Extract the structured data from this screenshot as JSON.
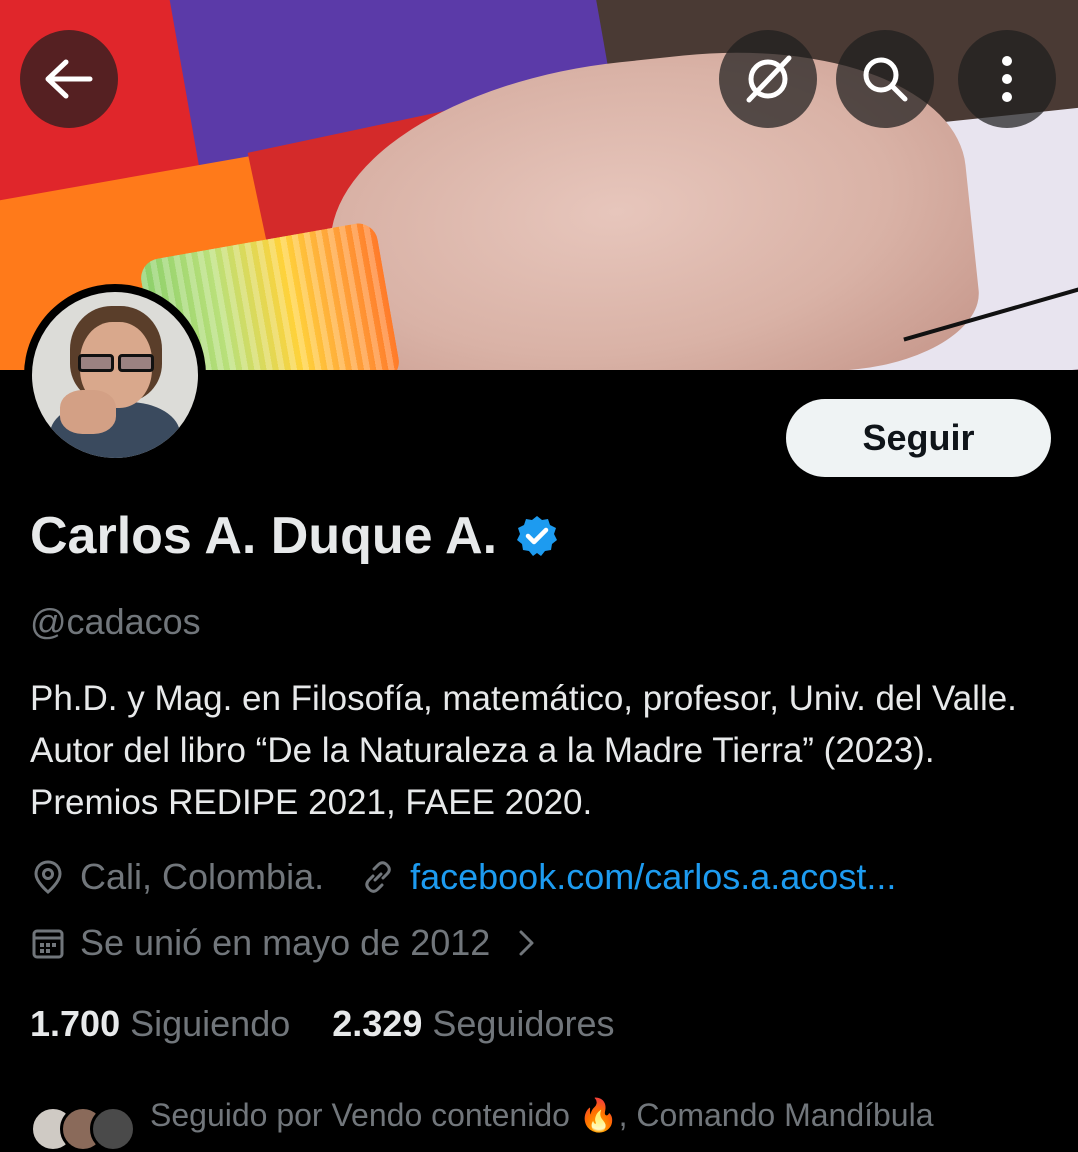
{
  "header": {
    "back_icon": "arrow-left-icon",
    "grok_icon": "grok-icon",
    "search_icon": "search-icon",
    "more_icon": "more-vertical-icon"
  },
  "profile": {
    "name": "Carlos A. Duque A.",
    "handle": "@cadacos",
    "verified": true,
    "bio": "Ph.D. y Mag. en Filosofía, matemático, profesor, Univ. del Valle. Autor del libro “De la Naturaleza a la Madre Tierra” (2023). Premios REDIPE 2021, FAEE 2020.",
    "location": "Cali, Colombia.",
    "website": "facebook.com/carlos.a.acost...",
    "joined": "Se unió en mayo de 2012",
    "follow_label": "Seguir",
    "following_count": "1.700",
    "following_label": "Siguiendo",
    "followers_count": "2.329",
    "followers_label": "Seguidores",
    "followed_by": "Seguido por Vendo contenido 🔥, Comando Mandíbula"
  },
  "colors": {
    "background": "#000000",
    "text": "#e7e9ea",
    "muted": "#71767b",
    "link": "#1d9bf0",
    "verified": "#1d9bf0",
    "follow_button_bg": "#eff3f4"
  }
}
